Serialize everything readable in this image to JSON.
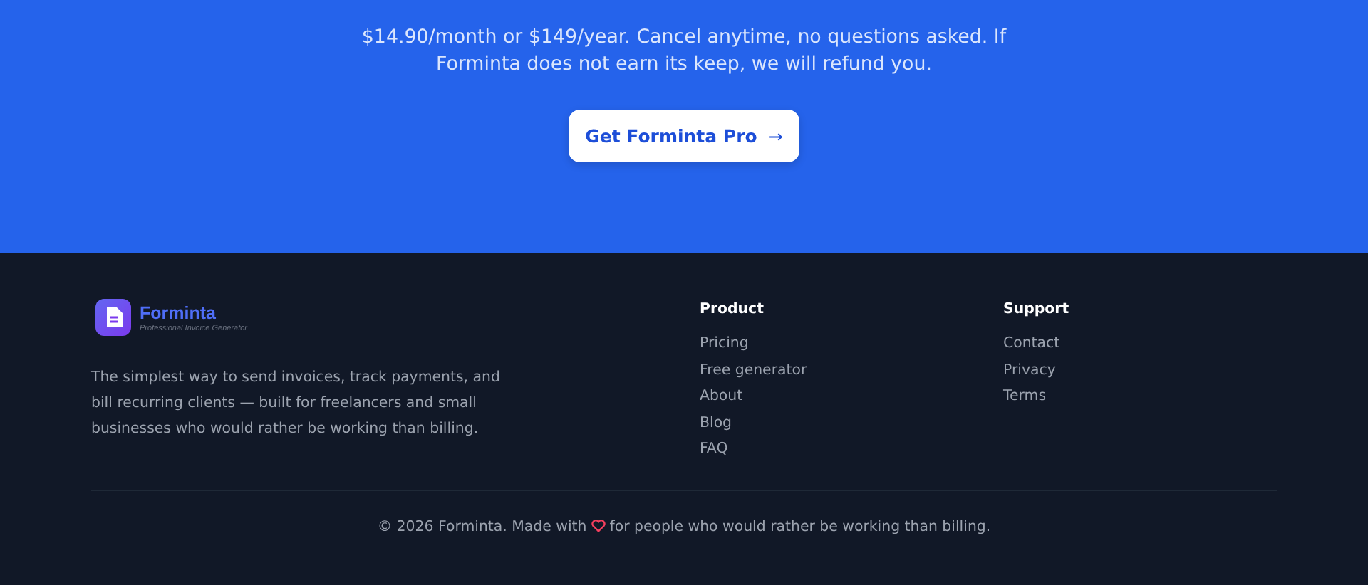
{
  "cta": {
    "text": "$14.90/month or $149/year. Cancel anytime, no questions asked. If Forminta does not earn its keep, we will refund you.",
    "button": {
      "label": "Get Forminta Pro",
      "icon": "→"
    }
  },
  "footer": {
    "brand": {
      "name": "Forminta",
      "tagline": "Professional Invoice Generator"
    },
    "description": "The simplest way to send invoices, track payments, and bill recurring clients — built for freelancers and small businesses who would rather be working than billing.",
    "columns": [
      {
        "title": "Product",
        "links": [
          "Pricing",
          "Free generator",
          "About",
          "Blog",
          "FAQ"
        ]
      },
      {
        "title": "Support",
        "links": [
          "Contact",
          "Privacy",
          "Terms"
        ]
      }
    ],
    "copyright": {
      "before": "© 2026 Forminta. Made with",
      "after": "for people who would rather be working than billing."
    }
  }
}
